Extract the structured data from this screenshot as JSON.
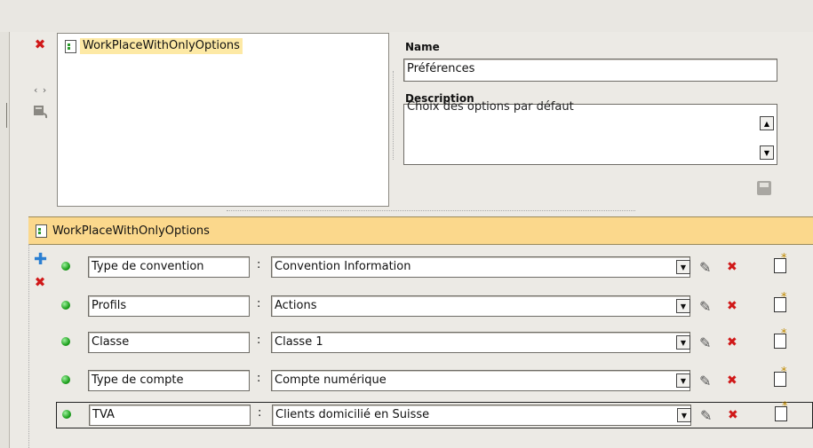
{
  "tree": {
    "items": [
      {
        "label": "WorkPlaceWithOnlyOptions"
      }
    ]
  },
  "form": {
    "name_label": "Name",
    "name_value": "Préférences",
    "description_label": "Description",
    "description_value": "Choix des options par défaut"
  },
  "section": {
    "title": "WorkPlaceWithOnlyOptions"
  },
  "options": [
    {
      "key": "Type de convention",
      "value": "Convention Information"
    },
    {
      "key": "Profils",
      "value": "Actions"
    },
    {
      "key": "Classe",
      "value": "Classe 1"
    },
    {
      "key": "Type de compte",
      "value": "Compte numérique"
    },
    {
      "key": "TVA",
      "value": "Clients domicilié en Suisse"
    }
  ],
  "icons": {
    "delete": "x-icon",
    "move": "arrows-icon",
    "copy": "copy-icon",
    "save": "save-icon",
    "add": "plus-icon",
    "edit": "pencil-icon",
    "new": "new-document-icon"
  },
  "colors": {
    "selection": "#fde9a5",
    "section_bar": "#fbd88c",
    "delete": "#d01818",
    "add": "#2b7fd2",
    "status_dot": "#1ea11e"
  }
}
